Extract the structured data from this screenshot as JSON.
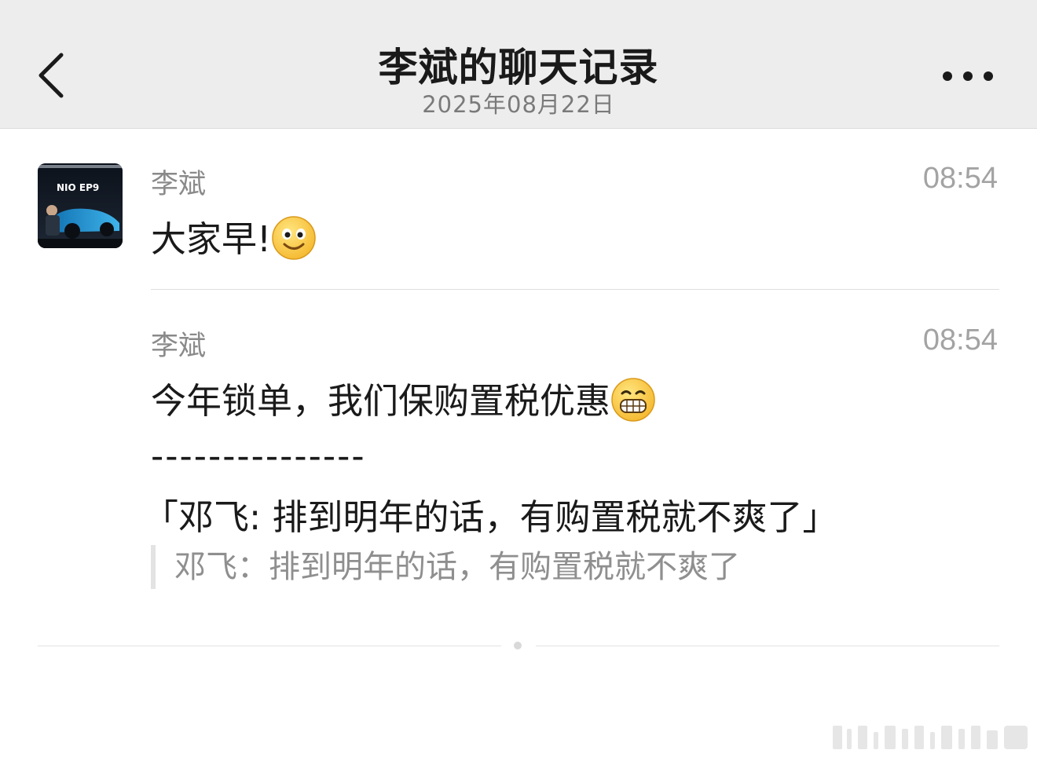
{
  "header": {
    "title": "李斌的聊天记录",
    "date": "2025年08月22日",
    "back_icon": "chevron-left-icon",
    "more_icon": "more-dots-icon"
  },
  "avatar": {
    "description": "nio-ep9-photo",
    "logo_text": "NIO EP9"
  },
  "messages": [
    {
      "sender": "李斌",
      "time": "08:54",
      "text": "大家早!",
      "emoji": "smile-emoji"
    },
    {
      "sender": "李斌",
      "time": "08:54",
      "text": "今年锁单，我们保购置税优惠",
      "emoji": "grin-emoji",
      "separator": "---------------",
      "reply_line": "「邓飞: 排到明年的话，有购置税就不爽了」",
      "quote": "邓飞：排到明年的话，有购置税就不爽了"
    }
  ],
  "colors": {
    "header_bg": "#ededed",
    "secondary_text": "#8a8a8a",
    "time_text": "#a3a3a3"
  }
}
